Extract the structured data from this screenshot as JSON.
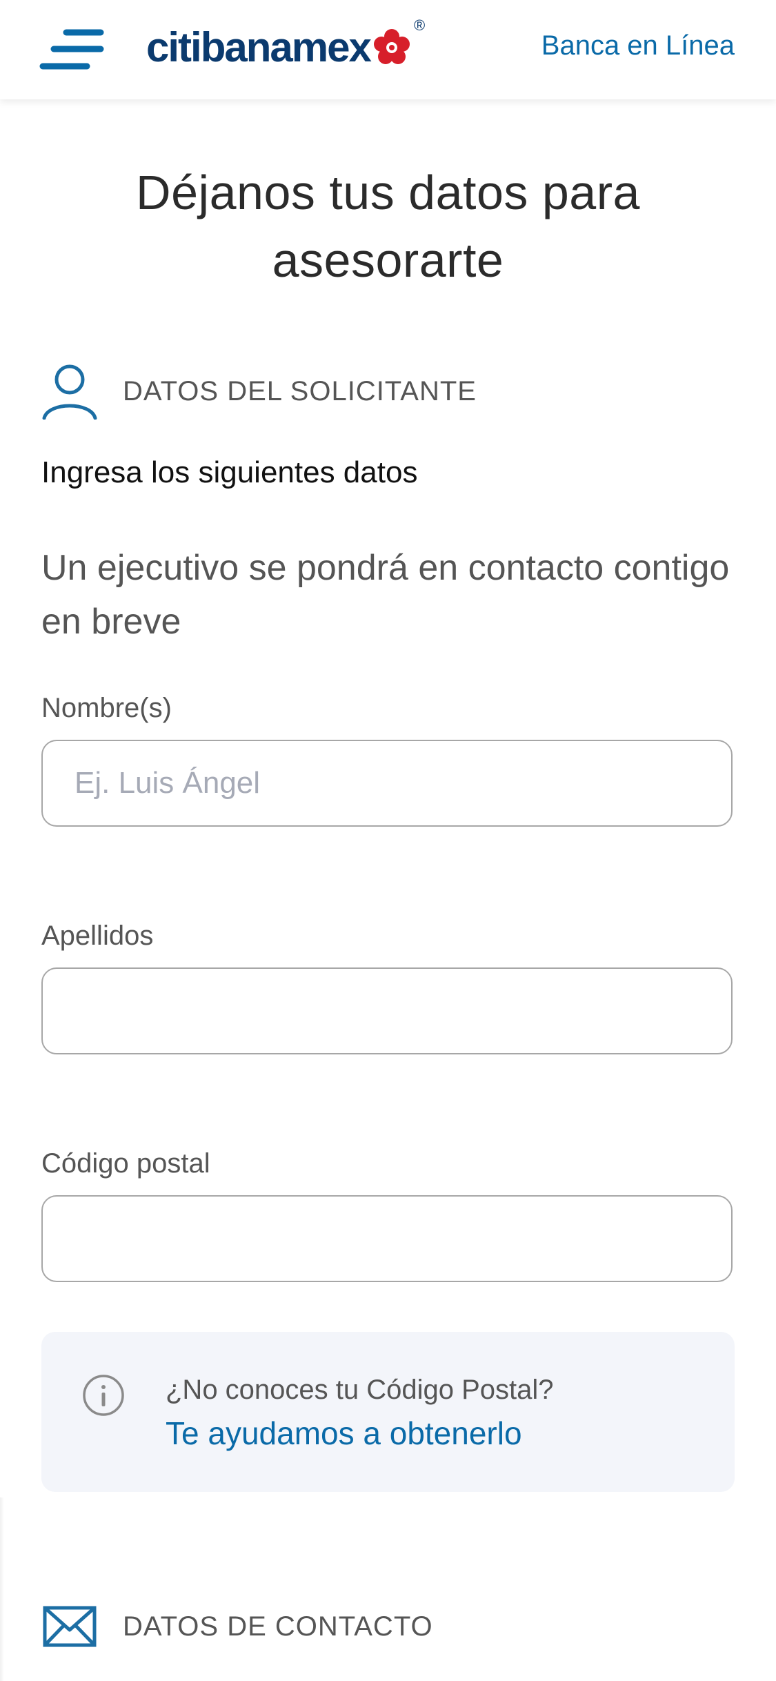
{
  "header": {
    "brand": "citibanamex",
    "registered": "®",
    "banca_link": "Banca en Línea"
  },
  "page": {
    "title_line1": "Déjanos tus datos para",
    "title_line2": "asesorarte"
  },
  "sections": {
    "applicant": {
      "label": "DATOS DEL SOLICITANTE",
      "icon": "user-icon"
    },
    "contact": {
      "label": "DATOS DE CONTACTO",
      "icon": "envelope-icon"
    }
  },
  "form": {
    "intro": "Ingresa los siguientes datos",
    "lead": "Un ejecutivo se pondrá en contacto contigo en breve",
    "fields": [
      {
        "label": "Nombre(s)",
        "placeholder": "Ej. Luis Ángel",
        "value": ""
      },
      {
        "label": "Apellidos",
        "placeholder": "",
        "value": ""
      },
      {
        "label": "Código postal",
        "placeholder": "",
        "value": ""
      }
    ]
  },
  "info": {
    "icon": "info-icon",
    "question": "¿No conoces tu Código Postal?",
    "link": "Te ayudamos a obtenerlo"
  },
  "colors": {
    "brand_blue": "#0b3a6e",
    "link_blue": "#0a6aa8",
    "icon_blue": "#1c6ea4",
    "brand_red": "#d71f2a"
  }
}
